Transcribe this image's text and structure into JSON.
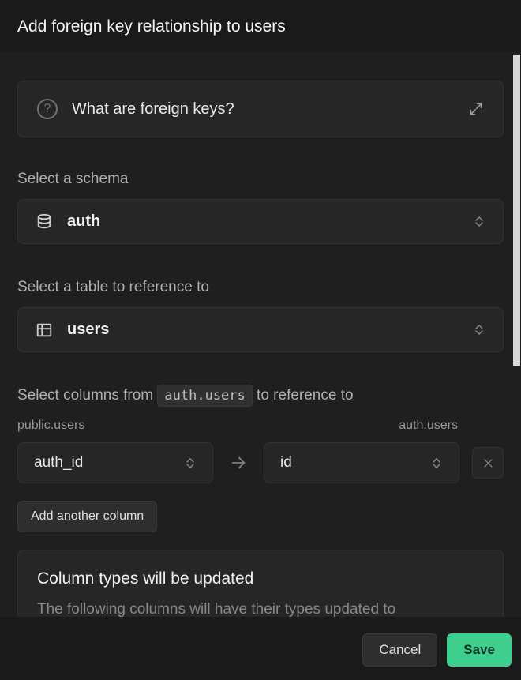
{
  "header": {
    "title": "Add foreign key relationship to users"
  },
  "info_card": {
    "text": "What are foreign keys?"
  },
  "schema_section": {
    "label": "Select a schema",
    "value": "auth"
  },
  "table_section": {
    "label": "Select a table to reference to",
    "value": "users"
  },
  "columns_section": {
    "label_prefix": "Select columns from",
    "label_code": "auth.users",
    "label_suffix": "to reference to",
    "source_table": "public.users",
    "target_table": "auth.users",
    "source_column": "auth_id",
    "target_column": "id",
    "add_button": "Add another column"
  },
  "update_card": {
    "title": "Column types will be updated",
    "text": "The following columns will have their types updated to"
  },
  "footer": {
    "cancel": "Cancel",
    "save": "Save"
  }
}
